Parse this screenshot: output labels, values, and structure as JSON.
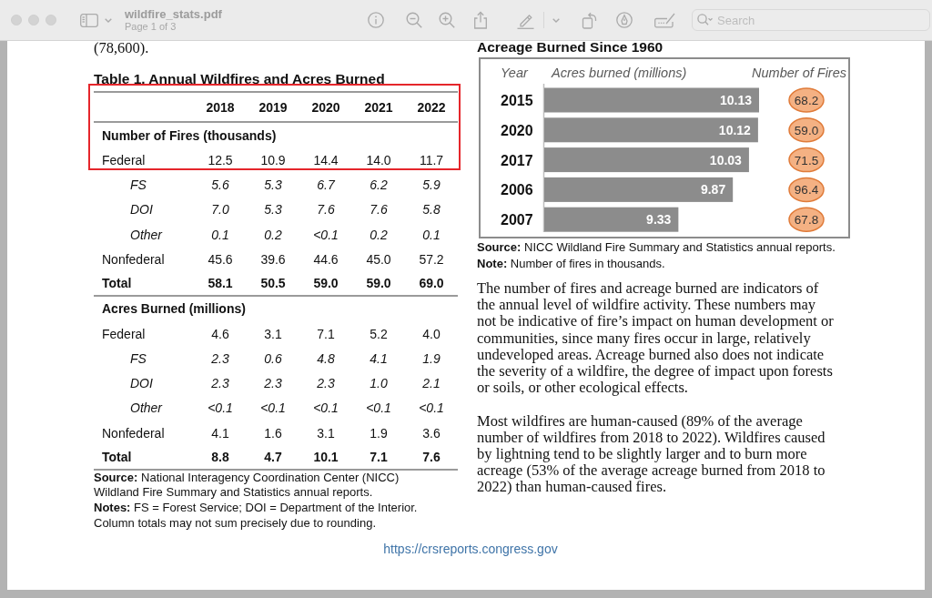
{
  "window": {
    "title": "wildfire_stats.pdf",
    "subtitle": "Page 1 of 3",
    "focused": false
  },
  "search": {
    "placeholder": "Search"
  },
  "page": {
    "left": {
      "text_fragment": "(78,600).",
      "table": {
        "title": "Table 1. Annual Wildfires and Acres Burned",
        "rows": [
          {
            "kind": "header",
            "cells": [
              "2018",
              "2019",
              "2020",
              "2021",
              "2022"
            ],
            "highlighted": true
          },
          {
            "kind": "section",
            "label": "Number of Fires (thousands)",
            "highlighted": true
          },
          {
            "kind": "main",
            "label": "Federal",
            "cells": [
              "12.5",
              "10.9",
              "14.4",
              "14.0",
              "11.7"
            ],
            "highlighted": true
          },
          {
            "kind": "sub",
            "label": "FS",
            "cells": [
              "5.6",
              "5.3",
              "6.7",
              "6.2",
              "5.9"
            ],
            "highlighted": false
          },
          {
            "kind": "sub",
            "label": "DOI",
            "cells": [
              "7.0",
              "5.3",
              "7.6",
              "7.6",
              "5.8"
            ],
            "highlighted": false
          },
          {
            "kind": "sub",
            "label": "Other",
            "cells": [
              "0.1",
              "0.2",
              "<0.1",
              "0.2",
              "0.1"
            ],
            "highlighted": false
          },
          {
            "kind": "main",
            "label": "Nonfederal",
            "cells": [
              "45.6",
              "39.6",
              "44.6",
              "45.0",
              "57.2"
            ],
            "highlighted": false
          },
          {
            "kind": "total",
            "label": "Total",
            "cells": [
              "58.1",
              "50.5",
              "59.0",
              "59.0",
              "69.0"
            ],
            "highlighted": false
          },
          {
            "kind": "section",
            "label": "Acres Burned (millions)",
            "highlighted": false
          },
          {
            "kind": "main",
            "label": "Federal",
            "cells": [
              "4.6",
              "3.1",
              "7.1",
              "5.2",
              "4.0"
            ],
            "highlighted": false
          },
          {
            "kind": "sub",
            "label": "FS",
            "cells": [
              "2.3",
              "0.6",
              "4.8",
              "4.1",
              "1.9"
            ],
            "highlighted": false
          },
          {
            "kind": "sub",
            "label": "DOI",
            "cells": [
              "2.3",
              "2.3",
              "2.3",
              "1.0",
              "2.1"
            ],
            "highlighted": false
          },
          {
            "kind": "sub",
            "label": "Other",
            "cells": [
              "<0.1",
              "<0.1",
              "<0.1",
              "<0.1",
              "<0.1"
            ],
            "highlighted": false
          },
          {
            "kind": "main",
            "label": "Nonfederal",
            "cells": [
              "4.1",
              "1.6",
              "3.1",
              "1.9",
              "3.6"
            ],
            "highlighted": false
          },
          {
            "kind": "total",
            "label": "Total",
            "cells": [
              "8.8",
              "4.7",
              "10.1",
              "7.1",
              "7.6"
            ],
            "highlighted": false
          }
        ],
        "notes": [
          "**Source:** National Interagency Coordination Center (NICC) Wildland Fire Summary and Statistics annual reports.",
          "**Notes:** FS = Forest Service; DOI = Department of the Interior. Column totals may not sum precisely due to rounding."
        ]
      }
    },
    "right": {
      "chart": {
        "chart_data": {
          "type": "bar",
          "orientation": "horizontal",
          "title": "Acreage Burned Since 1960",
          "xlabel": "Acres burned (millions)",
          "ylabel": "Year",
          "categories": [
            "2015",
            "2020",
            "2017",
            "2006",
            "2007"
          ],
          "values": [
            10.13,
            10.12,
            10.03,
            9.87,
            9.33
          ],
          "xlim": [
            8,
            10.13
          ],
          "data_labels": true
        },
        "fire_counts": {
          "label": "Number of Fires",
          "values": [
            "68.2",
            "59.0",
            "71.5",
            "96.4",
            "67.8"
          ]
        },
        "notes": [
          "**Source:** NICC Wildland Fire Summary and Statistics annual reports.",
          "**Note:** Number of fires in thousands."
        ]
      },
      "paragraphs": [
        "The number of fires and acreage burned are indicators of the annual level of wildfire activity. These numbers may not be indicative of fire’s impact on human development or communities, since many fires occur in large, relatively undeveloped areas. Acreage burned also does not indicate the severity of a wildfire, the degree of impact upon forests or soils, or other ecological effects.",
        "Most wildfires are human-caused (89% of the average number of wildfires from 2018 to 2022). Wildfires caused by lightning tend to be slightly larger and to burn more acreage (53% of the average acreage burned from 2018 to 2022) than human-caused fires."
      ]
    },
    "footer_link": "https://crsreports.congress.gov"
  }
}
